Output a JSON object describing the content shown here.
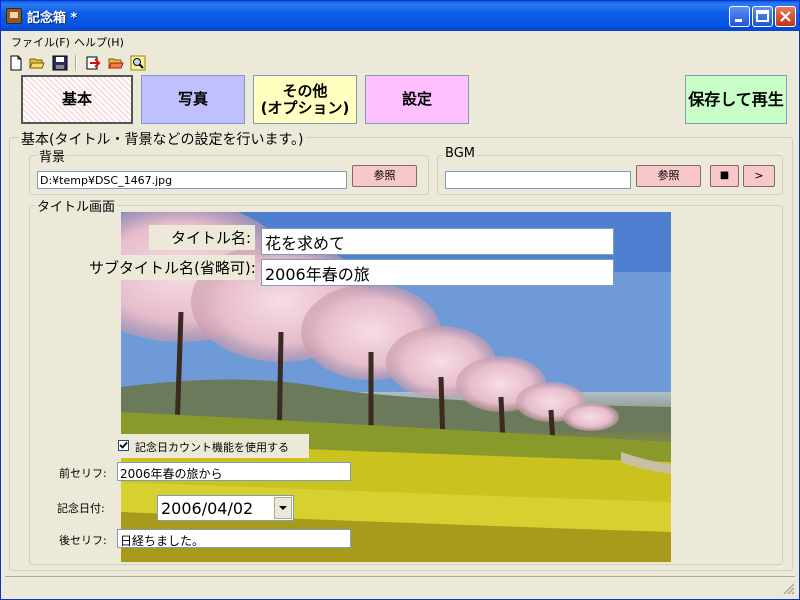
{
  "window": {
    "title": "記念箱 *"
  },
  "menu": [
    {
      "label": "ファイル(F)"
    },
    {
      "label": "ヘルプ(H)"
    }
  ],
  "toolbar_icons": [
    "new-file-icon",
    "open-folder-icon",
    "save-icon",
    "import-icon",
    "open-red-folder-icon",
    "search-icon"
  ],
  "tabs": [
    {
      "label": "基本",
      "active": true,
      "color": "#ffffff"
    },
    {
      "label": "写真",
      "color": "#c0c0ff"
    },
    {
      "label": "その他\n(オプション)",
      "color": "#ffffc0"
    },
    {
      "label": "設定",
      "color": "#ffc0ff"
    }
  ],
  "save_play_label": "保存して再生",
  "main_group": {
    "legend": "基本(タイトル・背景などの設定を行います。)"
  },
  "background": {
    "legend": "背景",
    "path": "D:¥temp¥DSC_1467.jpg",
    "browse_label": "参照"
  },
  "bgm": {
    "legend": "BGM",
    "path": "",
    "browse_label": "参照",
    "stop_label": "■",
    "play_label": ">"
  },
  "title_screen": {
    "legend": "タイトル画面",
    "title_label": "タイトル名:",
    "title_value": "花を求めて",
    "subtitle_label": "サブタイトル名(省略可):",
    "subtitle_value": "2006年春の旅",
    "countdown_label": "記念日カウント機能を使用する",
    "countdown_checked": true,
    "before_label": "前セリフ:",
    "before_value": "2006年春の旅から",
    "date_label": "記念日付:",
    "date_value": "2006/04/02",
    "after_label": "後セリフ:",
    "after_value": "日経ちました。"
  },
  "colors": {
    "titlebar": "#0a5ddf",
    "save_button": "#c8ffc8",
    "pink_button": "#f8c8c8"
  }
}
